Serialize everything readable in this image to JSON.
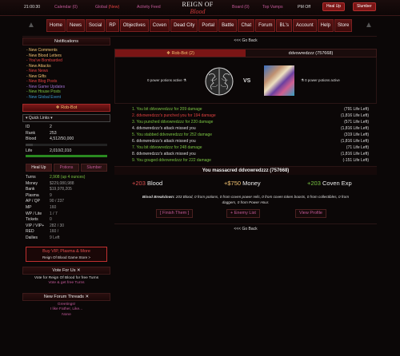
{
  "topbar": {
    "time": "21:00:30",
    "calendar_label": "Calendar",
    "calendar_count": "(0)",
    "global_label": "Global",
    "global_count": "(New)",
    "activity_label": "Activity Feed",
    "board_label": "Board",
    "board_count": "(0)",
    "top_vamps_label": "Top Vamps",
    "pm_label": "PM Off",
    "heal_up_label": "Heal Up",
    "slumber_label": "Slumber"
  },
  "logo": {
    "line1": "REIGN OF",
    "line2": "Blood"
  },
  "nav": [
    "Home",
    "News",
    "Social",
    "RP",
    "Objectives",
    "Coven",
    "Dead City",
    "Portal",
    "Battle",
    "Chat",
    "Forum",
    "BL's",
    "Account",
    "Help",
    "Store"
  ],
  "sidebar": {
    "notifications_title": "Notifications",
    "notifications": [
      {
        "text": "- New Comments",
        "color": "#f0c070"
      },
      {
        "text": "- New Blood Letters",
        "color": "#f0c070"
      },
      {
        "text": "- You've Bombarded",
        "color": "#e04040"
      },
      {
        "text": "- New Attacks",
        "color": "#f0c070"
      },
      {
        "text": "- New News",
        "color": "#e04040"
      },
      {
        "text": "- New Gifts",
        "color": "#f0c070"
      },
      {
        "text": "- New Blog Posts",
        "color": "#e04040"
      },
      {
        "text": "- New Game Updates",
        "color": "#a070d0"
      },
      {
        "text": "- New House Posts",
        "color": "#7ac443"
      },
      {
        "text": "- New Global Event",
        "color": "#3a9ad0"
      }
    ],
    "player_name": "Rob-Bot",
    "quick_links": "Quick Links",
    "stats": [
      {
        "k": "ID",
        "v": "2"
      },
      {
        "k": "Rank",
        "v": "253"
      },
      {
        "k": "Blood",
        "v": "4,512/50,000"
      }
    ],
    "blood_fill": 0.09,
    "life_label": "Life",
    "life_value": "2,010/2,010",
    "life_fill": 1.0,
    "tabs": [
      "Heal Up",
      "Potions",
      "Slumber"
    ],
    "stats2": [
      {
        "k": "Turns",
        "v": "2,908 (up 4 ounces)"
      },
      {
        "k": "Money",
        "v": "$229,080,988"
      },
      {
        "k": "Bank",
        "v": "$19,978,205"
      },
      {
        "k": "Plasma",
        "v": "9"
      },
      {
        "k": "AP / QP",
        "v": "90 / 237"
      },
      {
        "k": "MP",
        "v": "160"
      },
      {
        "k": "WP / Lite",
        "v": "1 / 7"
      },
      {
        "k": "Tickets",
        "v": "0"
      },
      {
        "k": "VIP / VIP+",
        "v": "282 / 30"
      },
      {
        "k": "RED",
        "v": "160 /"
      },
      {
        "k": "Dailies",
        "v": "9 Left"
      }
    ],
    "vip_line1": "Buy VIP, Plasma & More",
    "vip_line2": "Reign Of Blood Game Store >",
    "vote_title": "Vote For Us",
    "vote_line1": "Vote for Reign Of Blood for free Turns",
    "vote_line2": "Vote & get free Turns",
    "forum_title": "New Forum Threads",
    "forum_items": [
      "Greetings!",
      "I like Father, Like...",
      "None"
    ]
  },
  "main": {
    "go_back": "<<< Go Back",
    "attacker": "Rob-Bot (2)",
    "defender": "ddvowredzzz (757668)",
    "attacker_potions": "0 power potions active",
    "defender_potions": "0 power potions active",
    "vs": "VS",
    "log": [
      {
        "t": "1. You bit ddvowredzzz for 209 damage",
        "life": "(791 Life Left)",
        "c": "g"
      },
      {
        "t": "2. ddvowredzzz's punched you for 194 damage",
        "life": "(1,816 Life Left)",
        "c": "r"
      },
      {
        "t": "3. You punched ddvowredzzz for 220 damage",
        "life": "(571 Life Left)",
        "c": "g"
      },
      {
        "t": "4. ddvowredzzz's attack missed you",
        "life": "(1,816 Life Left)",
        "c": "w"
      },
      {
        "t": "5. You stabbed ddvowredzzz for 252 damage",
        "life": "(319 Life Left)",
        "c": "g"
      },
      {
        "t": "6. ddvowredzzz's attack missed you",
        "life": "(1,816 Life Left)",
        "c": "w"
      },
      {
        "t": "7. You bit ddvowredzzz for 248 damage",
        "life": "(71 Life Left)",
        "c": "g"
      },
      {
        "t": "8. ddvowredzzz's attack missed you",
        "life": "(1,816 Life Left)",
        "c": "w"
      },
      {
        "t": "9. You gouged ddvowredzzz for 222 damage",
        "life": "(-151 Life Left)",
        "c": "g"
      }
    ],
    "massacre": "You massacred ddvowredzzz (757668)",
    "rewards": [
      {
        "n": "+203",
        "l": " Blood",
        "c": ""
      },
      {
        "n": "+$750",
        "l": " Money",
        "c": "gold"
      },
      {
        "n": "+203",
        "l": " Coven Exp",
        "c": "green"
      }
    ],
    "breakdown_label": "Blood Breakdown:",
    "breakdown_text": "203 Blood, 0 from potions, 0 from coven power relic, 0 from coven token boosts, 0 from collectibles, 0 from daggers, 0 from Power Hour.",
    "actions": [
      "[ Finish Them ]",
      "+ Enemy List",
      "View Profile"
    ]
  }
}
